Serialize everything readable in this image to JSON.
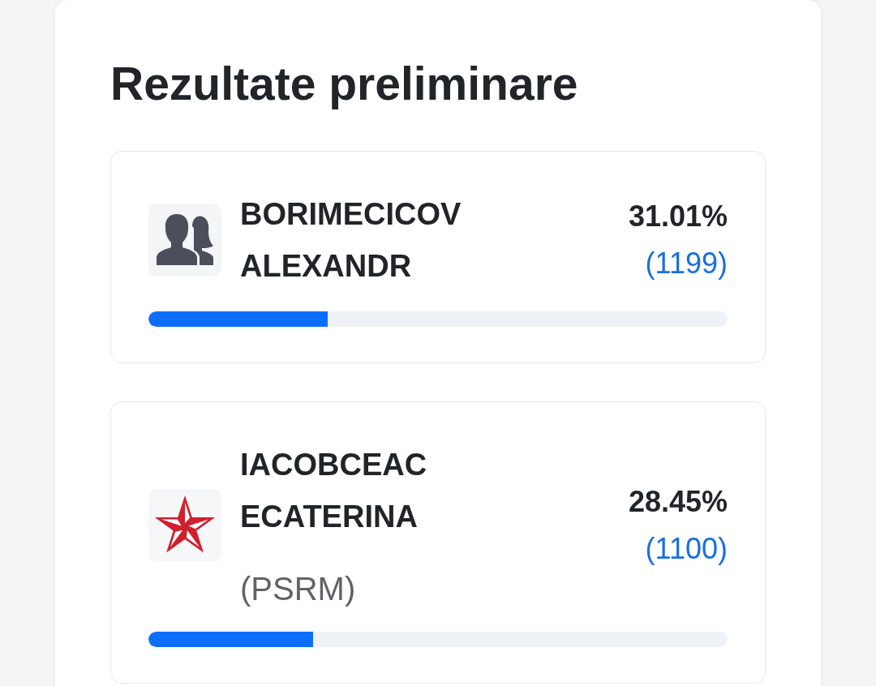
{
  "title": "Rezultate preliminare",
  "candidates": [
    {
      "kind": "independent",
      "name": "BORIMECICOV ALEXANDR",
      "percent": "31.01%",
      "votes": "(1199)",
      "level": 0.3101
    },
    {
      "kind": "party",
      "name": "IACOBCEAC ECATERINA",
      "party": "(PSRM)",
      "percent": "28.45%",
      "votes": "(1100)",
      "level": 0.2845
    }
  ]
}
